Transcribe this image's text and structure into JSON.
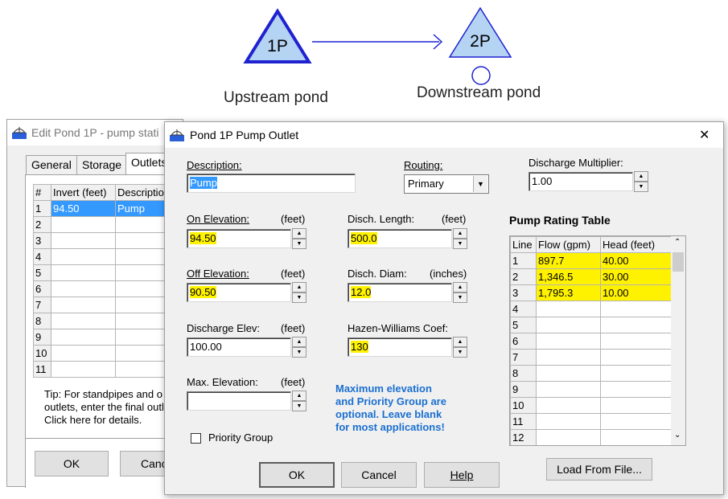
{
  "diagram": {
    "upstream": {
      "label": "1P",
      "caption": "Upstream pond"
    },
    "downstream": {
      "label": "2P",
      "caption": "Downstream pond"
    }
  },
  "edit_window": {
    "title": "Edit Pond 1P - pump stati",
    "tabs": [
      "General",
      "Storage",
      "Outlets"
    ],
    "grid_headers": [
      "#",
      "Invert (feet)",
      "Descriptio"
    ],
    "rows": [
      {
        "n": "1",
        "invert": "94.50",
        "desc": "Pump"
      },
      {
        "n": "2",
        "invert": "",
        "desc": ""
      },
      {
        "n": "3",
        "invert": "",
        "desc": ""
      },
      {
        "n": "4",
        "invert": "",
        "desc": ""
      },
      {
        "n": "5",
        "invert": "",
        "desc": ""
      },
      {
        "n": "6",
        "invert": "",
        "desc": ""
      },
      {
        "n": "7",
        "invert": "",
        "desc": ""
      },
      {
        "n": "8",
        "invert": "",
        "desc": ""
      },
      {
        "n": "9",
        "invert": "",
        "desc": ""
      },
      {
        "n": "10",
        "invert": "",
        "desc": ""
      },
      {
        "n": "11",
        "invert": "",
        "desc": ""
      }
    ],
    "tip_lines": [
      "Tip: For standpipes and o",
      "outlets, enter the final outl",
      "Click here for details."
    ],
    "ok_label": "OK",
    "cancel_label": "Canc"
  },
  "pump_window": {
    "title": "Pond 1P Pump Outlet",
    "close_glyph": "✕",
    "description": {
      "label": "Description:",
      "value": "Pump"
    },
    "routing": {
      "label": "Routing:",
      "value": "Primary"
    },
    "discharge_multiplier": {
      "label": "Discharge Multiplier:",
      "value": "1.00"
    },
    "on_elevation": {
      "label": "On Elevation:",
      "unit": "(feet)",
      "value": "94.50"
    },
    "off_elevation": {
      "label": "Off Elevation:",
      "unit": "(feet)",
      "value": "90.50"
    },
    "discharge_elev": {
      "label": "Discharge Elev:",
      "unit": "(feet)",
      "value": "100.00"
    },
    "max_elevation": {
      "label": "Max. Elevation:",
      "unit": "(feet)",
      "value": ""
    },
    "disch_length": {
      "label": "Disch. Length:",
      "unit": "(feet)",
      "value": "500.0"
    },
    "disch_diam": {
      "label": "Disch. Diam:",
      "unit": "(inches)",
      "value": "12.0"
    },
    "hazen": {
      "label": "Hazen-Williams Coef:",
      "value": "130"
    },
    "priority_group": {
      "label": "Priority Group"
    },
    "note": "Maximum elevation\nand Priority Group are\noptional.  Leave blank\nfor most applications!",
    "rating_table": {
      "title": "Pump Rating Table",
      "headers": [
        "Line",
        "Flow (gpm)",
        "Head (feet)"
      ],
      "rows": [
        {
          "line": "1",
          "flow": "897.7",
          "head": "40.00"
        },
        {
          "line": "2",
          "flow": "1,346.5",
          "head": "30.00"
        },
        {
          "line": "3",
          "flow": "1,795.3",
          "head": "10.00"
        },
        {
          "line": "4",
          "flow": "",
          "head": ""
        },
        {
          "line": "5",
          "flow": "",
          "head": ""
        },
        {
          "line": "6",
          "flow": "",
          "head": ""
        },
        {
          "line": "7",
          "flow": "",
          "head": ""
        },
        {
          "line": "8",
          "flow": "",
          "head": ""
        },
        {
          "line": "9",
          "flow": "",
          "head": ""
        },
        {
          "line": "10",
          "flow": "",
          "head": ""
        },
        {
          "line": "11",
          "flow": "",
          "head": ""
        },
        {
          "line": "12",
          "flow": "",
          "head": ""
        }
      ]
    },
    "load_label": "Load From File...",
    "ok_label": "OK",
    "cancel_label": "Cancel",
    "help_label": "Help"
  },
  "colors": {
    "triangle_fill": "#b5d3f3",
    "triangle_stroke": "#1e22d0",
    "highlight": "#fff200",
    "selection": "#3399ff",
    "note_text": "#1a6fd1"
  }
}
